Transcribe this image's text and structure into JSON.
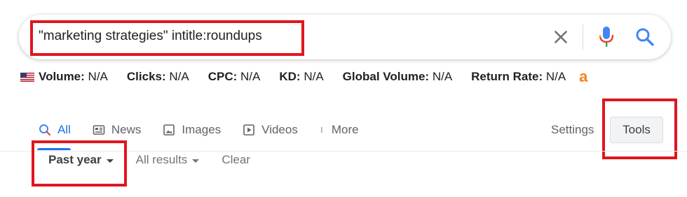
{
  "search": {
    "query": "\"marketing strategies\" intitle:roundups"
  },
  "keyword_stats": {
    "items": [
      {
        "label": "Volume:",
        "value": "N/A"
      },
      {
        "label": "Clicks:",
        "value": "N/A"
      },
      {
        "label": "CPC:",
        "value": "N/A"
      },
      {
        "label": "KD:",
        "value": "N/A"
      },
      {
        "label": "Global Volume:",
        "value": "N/A"
      },
      {
        "label": "Return Rate:",
        "value": "N/A"
      }
    ],
    "amazon_badge": "a"
  },
  "tabs": {
    "items": [
      {
        "label": "All",
        "icon": "search-icon"
      },
      {
        "label": "News",
        "icon": "news-icon"
      },
      {
        "label": "Images",
        "icon": "image-icon"
      },
      {
        "label": "Videos",
        "icon": "video-play-icon"
      },
      {
        "label": "More",
        "icon": "more-vert-icon"
      }
    ],
    "settings": "Settings",
    "tools": "Tools"
  },
  "filters": {
    "time": "Past year",
    "results": "All results",
    "clear": "Clear"
  },
  "colors": {
    "accent_blue": "#1a73e8",
    "highlight_red": "#e0161f",
    "amazon_orange": "#f58220"
  }
}
